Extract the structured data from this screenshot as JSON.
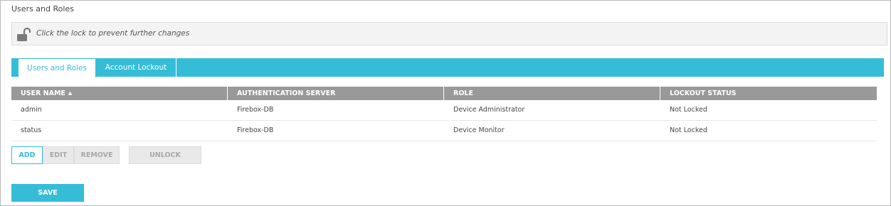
{
  "page": {
    "title": "Users and Roles"
  },
  "lock": {
    "icon": "unlocked-padlock-icon",
    "message": "Click the lock to prevent further changes"
  },
  "tabs": [
    {
      "label": "Users and Roles",
      "active": true
    },
    {
      "label": "Account Lockout",
      "active": false
    }
  ],
  "table": {
    "columns": [
      "USER NAME",
      "AUTHENTICATION SERVER",
      "ROLE",
      "LOCKOUT STATUS"
    ],
    "sort": {
      "column": "USER NAME",
      "icon": "sort-ascending-icon"
    },
    "rows": [
      [
        "admin",
        "Firebox-DB",
        "Device Administrator",
        "Not Locked"
      ],
      [
        "status",
        "Firebox-DB",
        "Device Monitor",
        "Not Locked"
      ]
    ]
  },
  "buttons": {
    "add": "ADD",
    "edit": "EDIT",
    "remove": "REMOVE",
    "unlock": "UNLOCK",
    "save": "SAVE"
  },
  "colors": {
    "accent": "#35bdd8",
    "header_gray": "#999999",
    "disabled_bg": "#e9e9e9"
  }
}
